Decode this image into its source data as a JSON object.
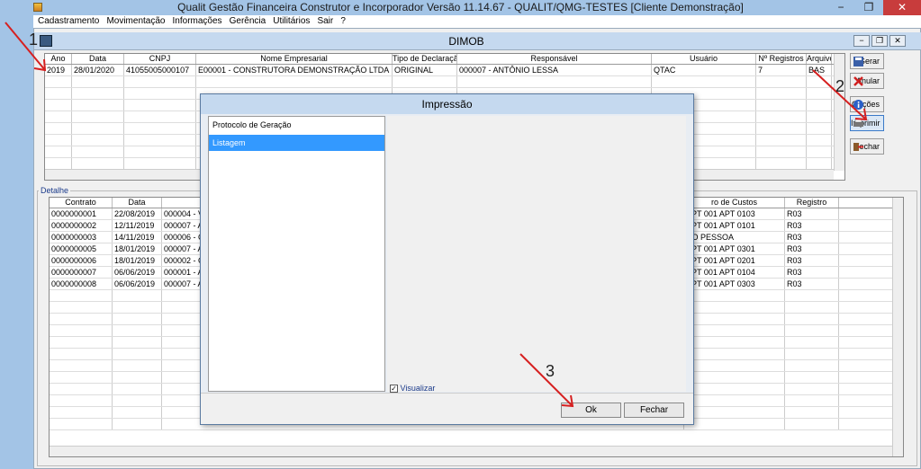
{
  "window": {
    "title": "Qualit Gestão Financeira Construtor e Incorporador Versão 11.14.67 - QUALIT/QMG-TESTES [Cliente Demonstração]",
    "minimize": "−",
    "maximize": "❐",
    "close": "✕"
  },
  "menu": [
    {
      "label": "Cadastramento"
    },
    {
      "label": "Movimentação"
    },
    {
      "label": "Informações"
    },
    {
      "label": "Gerência"
    },
    {
      "label": "Utilitários"
    },
    {
      "label": "Sair"
    },
    {
      "label": "?"
    }
  ],
  "child": {
    "title": "DIMOB"
  },
  "top_grid": {
    "columns": [
      "Ano",
      "Data",
      "CNPJ",
      "Nome Empresarial",
      "Tipo de Declaração",
      "Responsável",
      "Usuário",
      "Nº Registros",
      "Arquivo"
    ],
    "rows": [
      [
        "2019",
        "28/01/2020",
        "41055005000107",
        "E00001 - CONSTRUTORA DEMONSTRAÇÃO LTDA",
        "ORIGINAL",
        "000007 - ANTÔNIO LESSA",
        "QTAC",
        "7",
        "BAS"
      ]
    ]
  },
  "side_buttons": [
    {
      "label": "Gerar",
      "icon": "save-icon"
    },
    {
      "label": "Anular",
      "icon": "delete-icon"
    },
    {
      "label": "Opções",
      "icon": "info-icon"
    },
    {
      "label": "Imprimir",
      "icon": "printer-icon"
    },
    {
      "label": "Fechar",
      "icon": "exit-icon"
    }
  ],
  "detail": {
    "group_label": "Detalhe",
    "columns": [
      "Contrato",
      "Data",
      "",
      "ro de Custos",
      "Registro"
    ],
    "rows": [
      [
        "0000000001",
        "22/08/2019",
        "000004 - VI",
        "APT 001 APT 0103",
        "R03"
      ],
      [
        "0000000002",
        "12/11/2019",
        "000007 - AI",
        "APT 001 APT 0101",
        "R03"
      ],
      [
        "0000000003",
        "14/11/2019",
        "000006 - CA",
        "DO PESSOA",
        "R03"
      ],
      [
        "0000000005",
        "18/01/2019",
        "000007 - AI",
        "APT 001 APT 0301",
        "R03"
      ],
      [
        "0000000006",
        "18/01/2019",
        "000002 - CA",
        "APT 001 APT 0201",
        "R03"
      ],
      [
        "0000000007",
        "06/06/2019",
        "000001 - AI",
        "APT 001 APT 0104",
        "R03"
      ],
      [
        "0000000008",
        "06/06/2019",
        "000007 - AI",
        "APT 001 APT 0303",
        "R03"
      ]
    ]
  },
  "dialog": {
    "title": "Impressão",
    "items": [
      "Protocolo de Geração",
      "Listagem"
    ],
    "selected_index": 1,
    "checkbox_label": "Visualizar",
    "checkbox_checked": true,
    "check_mark": "✓",
    "ok_label": "Ok",
    "close_label": "Fechar"
  },
  "annotations": [
    "1",
    "2",
    "3"
  ],
  "colors": {
    "selection": "#3399ff",
    "arrow": "#d62020"
  }
}
